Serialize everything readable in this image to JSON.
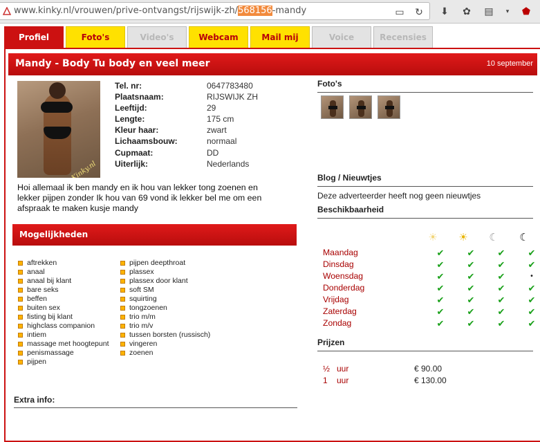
{
  "browser": {
    "url_prefix": "www.kinky.nl/vrouwen/prive-ontvangst/rijswijk-zh/",
    "url_selected": "568156",
    "url_suffix": "-mandy"
  },
  "tabs": [
    {
      "label": "Profiel",
      "state": "active"
    },
    {
      "label": "Foto's",
      "state": "yellow"
    },
    {
      "label": "Video's",
      "state": "disabled"
    },
    {
      "label": "Webcam",
      "state": "yellow"
    },
    {
      "label": "Mail mij",
      "state": "yellow"
    },
    {
      "label": "Voice",
      "state": "disabled"
    },
    {
      "label": "Recensies",
      "state": "disabled"
    }
  ],
  "profile": {
    "title": "Mandy - Body Tu body en veel meer",
    "date": "10 september",
    "photo_watermark": "Kinky.nl",
    "details": [
      {
        "label": "Tel. nr:",
        "value": "0647783480"
      },
      {
        "label": "Plaatsnaam:",
        "value": "RIJSWIJK ZH"
      },
      {
        "label": "Leeftijd:",
        "value": "29"
      },
      {
        "label": "Lengte:",
        "value": "175 cm"
      },
      {
        "label": "Kleur haar:",
        "value": "zwart"
      },
      {
        "label": "Lichaamsbouw:",
        "value": "normaal"
      },
      {
        "label": "Cupmaat:",
        "value": "DD"
      },
      {
        "label": "Uiterlijk:",
        "value": "Nederlands"
      }
    ],
    "bio": "Hoi allemaal ik ben mandy en ik hou van lekker tong zoenen en lekker pijpen zonder Ik hou van 69 vond ik lekker bel me om een afspraak te maken kusje mandy"
  },
  "mogelijkheden": {
    "title": "Mogelijkheden",
    "col1": [
      "aftrekken",
      "anaal",
      "anaal bij klant",
      "bare seks",
      "beffen",
      "buiten sex",
      "fisting bij klant",
      "highclass companion",
      "intiem",
      "massage met hoogtepunt",
      "penismassage",
      "pijpen"
    ],
    "col2": [
      "pijpen deepthroat",
      "plassex",
      "plassex door klant",
      "soft SM",
      "squirting",
      "tongzoenen",
      "trio m/m",
      "trio m/v",
      "tussen borsten (russisch)",
      "vingeren",
      "zoenen"
    ]
  },
  "extra_info": {
    "title": "Extra info:"
  },
  "fotos": {
    "title": "Foto's",
    "count": 3
  },
  "blog": {
    "title": "Blog / Nieuwtjes",
    "text": "Deze adverteerder heeft nog geen nieuwtjes"
  },
  "beschikbaarheid": {
    "title": "Beschikbaarheid",
    "period_icons": [
      "morning-sun-icon",
      "afternoon-sun-icon",
      "evening-moon-icon",
      "night-moon-icon"
    ],
    "days": [
      {
        "name": "Maandag",
        "slots": [
          "✔",
          "✔",
          "✔",
          "✔"
        ]
      },
      {
        "name": "Dinsdag",
        "slots": [
          "✔",
          "✔",
          "✔",
          "✔"
        ]
      },
      {
        "name": "Woensdag",
        "slots": [
          "✔",
          "✔",
          "✔",
          "•"
        ]
      },
      {
        "name": "Donderdag",
        "slots": [
          "✔",
          "✔",
          "✔",
          "✔"
        ]
      },
      {
        "name": "Vrijdag",
        "slots": [
          "✔",
          "✔",
          "✔",
          "✔"
        ]
      },
      {
        "name": "Zaterdag",
        "slots": [
          "✔",
          "✔",
          "✔",
          "✔"
        ]
      },
      {
        "name": "Zondag",
        "slots": [
          "✔",
          "✔",
          "✔",
          "✔"
        ]
      }
    ]
  },
  "prijzen": {
    "title": "Prijzen",
    "rows": [
      {
        "qty": "½",
        "unit": "uur",
        "price": "€ 90.00"
      },
      {
        "qty": "1",
        "unit": "uur",
        "price": "€ 130.00"
      }
    ]
  },
  "colors": {
    "brand_red": "#cc1111",
    "tab_yellow": "#ffe100",
    "check_green": "#19a019",
    "day_red": "#a80000"
  }
}
